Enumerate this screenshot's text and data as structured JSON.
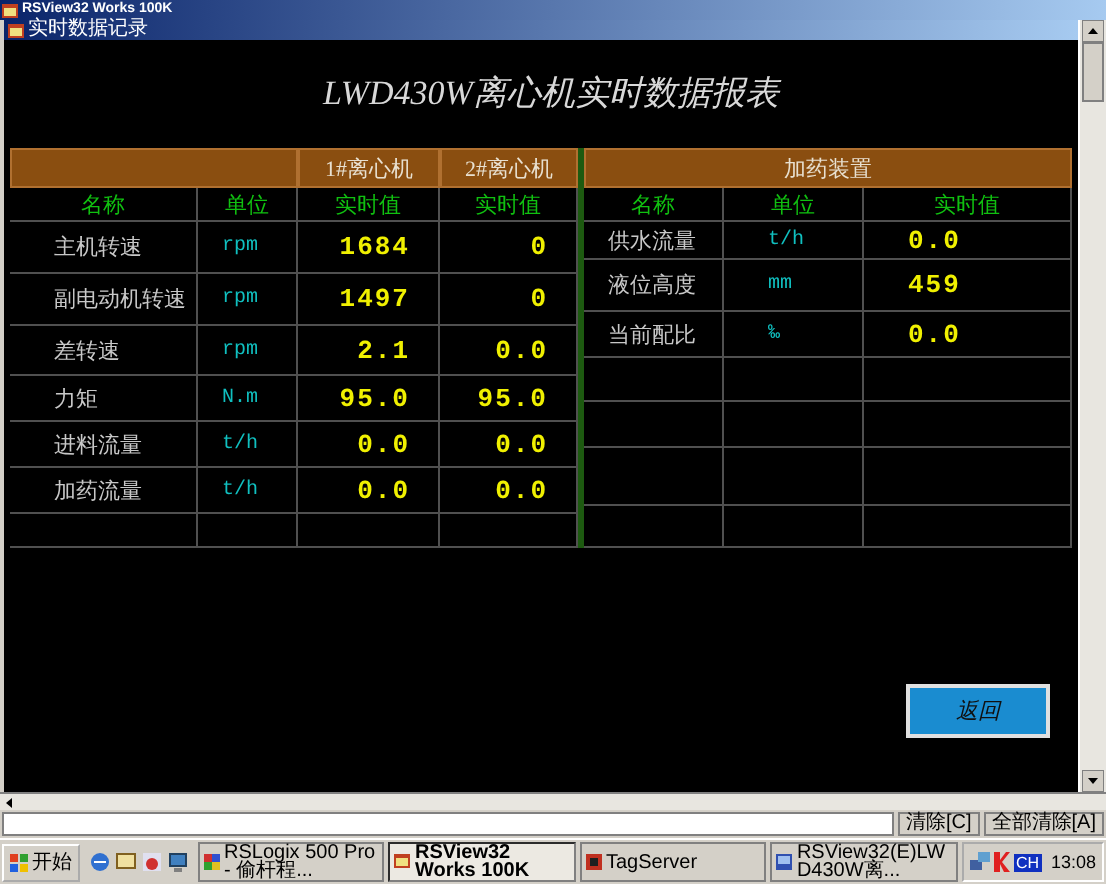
{
  "app_window": {
    "title": "RSView32 Works 100K"
  },
  "display": {
    "title": "实时数据记录",
    "heading": "LWD430W离心机实时数据报表",
    "centrifuge_table": {
      "group_headers": [
        "1#离心机",
        "2#离心机"
      ],
      "columns": [
        "名称",
        "单位",
        "实时值",
        "实时值"
      ],
      "rows": [
        {
          "name": "主机转速",
          "unit": "rpm",
          "values": [
            "1684",
            "0"
          ]
        },
        {
          "name": "副电动机转速",
          "unit": "rpm",
          "values": [
            "1497",
            "0"
          ]
        },
        {
          "name": "差转速",
          "unit": "rpm",
          "values": [
            "2.1",
            "0.0"
          ]
        },
        {
          "name": "力矩",
          "unit": "N.m",
          "values": [
            "95.0",
            "95.0"
          ]
        },
        {
          "name": "进料流量",
          "unit": "t/h",
          "values": [
            "0.0",
            "0.0"
          ]
        },
        {
          "name": "加药流量",
          "unit": "t/h",
          "values": [
            "0.0",
            "0.0"
          ]
        }
      ]
    },
    "dosing_table": {
      "group_header": "加药装置",
      "columns": [
        "名称",
        "单位",
        "实时值"
      ],
      "rows": [
        {
          "name": "供水流量",
          "unit": "t/h",
          "value": "0.0"
        },
        {
          "name": "液位高度",
          "unit": "mm",
          "value": "459"
        },
        {
          "name": "当前配比",
          "unit": "‰",
          "value": "0.0"
        }
      ]
    },
    "back_button": "返回"
  },
  "message_bar": {
    "buttons": [
      "清除[C]",
      "全部清除[A]"
    ]
  },
  "taskbar": {
    "start": "开始",
    "tasks": [
      {
        "label": "RSLogix 500 Pro - 偷杆程...",
        "selected": false
      },
      {
        "label": "RSView32 Works 100K",
        "selected": true
      },
      {
        "label": "TagServer",
        "selected": false
      },
      {
        "label": "RSView32(E)LWD430W离...",
        "selected": false
      }
    ],
    "tray": {
      "language": "CH",
      "time": "13:08"
    }
  }
}
